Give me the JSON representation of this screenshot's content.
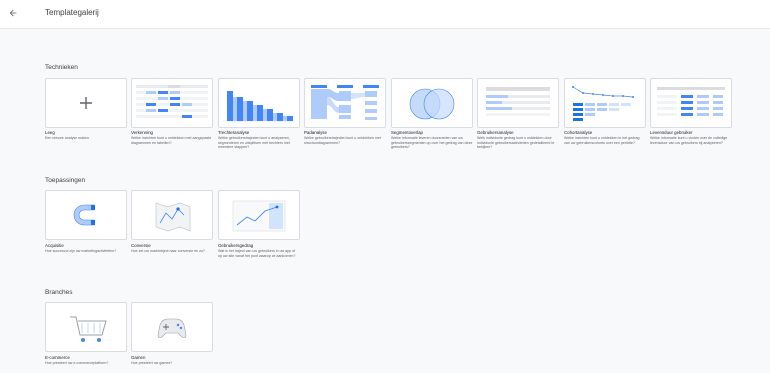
{
  "header": {
    "title": "Templategalerij",
    "back_icon": "arrow-left-icon"
  },
  "colors": {
    "accent": "#1a73e8",
    "light_accent": "#aecbfa",
    "card_border": "#dadce0",
    "background": "#f8f9fa"
  },
  "sections": [
    {
      "title": "Technieken",
      "cards": [
        {
          "label": "Leeg",
          "desc": "Een nieuwe analyse maken",
          "thumb": "plus-icon"
        },
        {
          "label": "Verkenning",
          "desc": "Welke inzichten kunt u ontdekken met aangepaste diagrammen en tabellen?",
          "thumb": "table-chart"
        },
        {
          "label": "Trechteranalyse",
          "desc": "Welke gebruikerstrajecten kunt u analyseren, segmenteren en uitsplitsen met trechters met meerdere stappen?",
          "thumb": "funnel-chart"
        },
        {
          "label": "Padanalyse",
          "desc": "Welke gebruikerstrajecten kunt u ontdekken met structuurdiagrammen?",
          "thumb": "path-chart"
        },
        {
          "label": "Segmentoverlap",
          "desc": "Welke informatie leveren doorsneden van uw gebruikerssegmenten op over het gedrag van deze gebruikers?",
          "thumb": "venn-chart"
        },
        {
          "label": "Gebruikersanalyse",
          "desc": "Welk individuele gedrag kunt u ontdekken door individuele gebruikersactiviteiten gedetailleerd te bekijken?",
          "thumb": "user-explorer"
        },
        {
          "label": "Cohortanalyse",
          "desc": "Welke inzichten kunt u ontdekken in het gedrag van uw gebruikerscohorts over een periode?",
          "thumb": "cohort-chart"
        },
        {
          "label": "Levensduur gebruiker",
          "desc": "Welke informatie kunt u vinden over de volledige levensduur van uw gebruikers bij analyseren?",
          "thumb": "lifetime-table"
        }
      ]
    },
    {
      "title": "Toepassingen",
      "cards": [
        {
          "label": "Acquisitie",
          "desc": "Hoe succesvol zijn uw marketingactiviteiten?",
          "thumb": "magnet-icon"
        },
        {
          "label": "Conversie",
          "desc": "Hoe zet uw marktobject naar conversie en zo?",
          "thumb": "map-icon"
        },
        {
          "label": "Gebruikersgedrag",
          "desc": "Wat is het traject van uw gebruikers in uw app of op uw site vanaf het punt waarop ze aankomen?",
          "thumb": "trend-icon"
        }
      ]
    },
    {
      "title": "Branches",
      "cards": [
        {
          "label": "E-commerce",
          "desc": "Hoe presteert uw e-commerceplatform?",
          "thumb": "cart-icon"
        },
        {
          "label": "Gamen",
          "desc": "Hoe presteert uw games?",
          "thumb": "gamepad-icon"
        }
      ]
    }
  ]
}
